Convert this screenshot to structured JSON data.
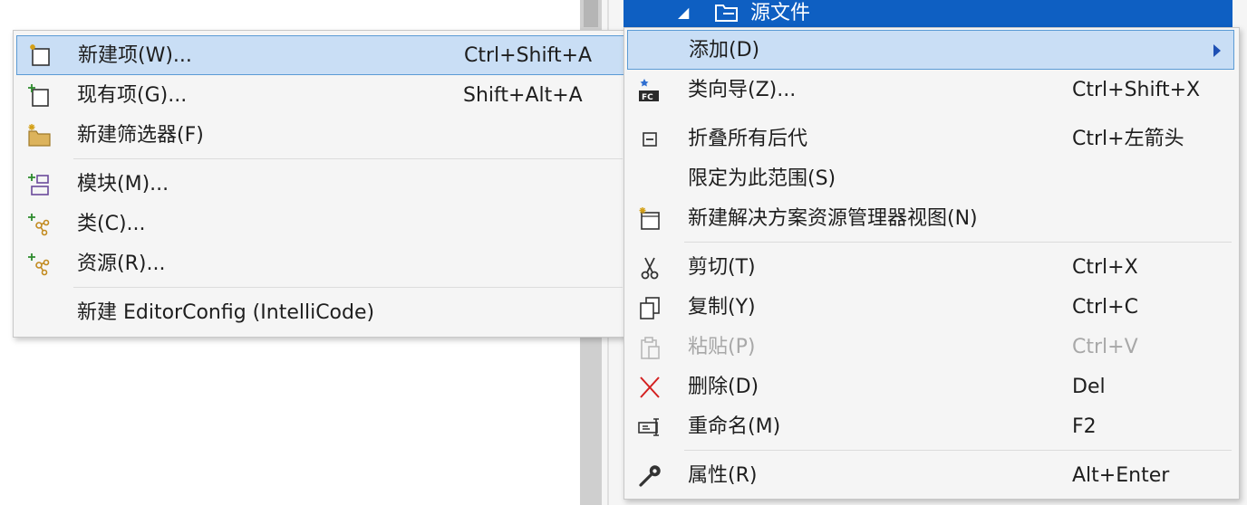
{
  "tree": {
    "selected_label": "源文件"
  },
  "left_menu": {
    "items": [
      {
        "label": "新建项(W)...",
        "shortcut": "Ctrl+Shift+A",
        "icon": "new-item-icon"
      },
      {
        "label": "现有项(G)...",
        "shortcut": "Shift+Alt+A",
        "icon": "existing-item-icon"
      },
      {
        "label": "新建筛选器(F)",
        "shortcut": "",
        "icon": "new-filter-folder-icon"
      },
      {
        "label": "模块(M)...",
        "shortcut": "",
        "icon": "module-icon"
      },
      {
        "label": "类(C)...",
        "shortcut": "",
        "icon": "class-icon"
      },
      {
        "label": "资源(R)...",
        "shortcut": "",
        "icon": "resource-icon"
      },
      {
        "label": "新建 EditorConfig (IntelliCode)",
        "shortcut": "",
        "icon": ""
      }
    ]
  },
  "right_menu": {
    "items": [
      {
        "label": "添加(D)",
        "shortcut": "",
        "icon": ""
      },
      {
        "label": "类向导(Z)...",
        "shortcut": "Ctrl+Shift+X",
        "icon": "class-wizard-icon"
      },
      {
        "label": "折叠所有后代",
        "shortcut": "Ctrl+左箭头",
        "icon": "collapse-icon"
      },
      {
        "label": "限定为此范围(S)",
        "shortcut": "",
        "icon": ""
      },
      {
        "label": "新建解决方案资源管理器视图(N)",
        "shortcut": "",
        "icon": "new-view-icon"
      },
      {
        "label": "剪切(T)",
        "shortcut": "Ctrl+X",
        "icon": "cut-icon"
      },
      {
        "label": "复制(Y)",
        "shortcut": "Ctrl+C",
        "icon": "copy-icon"
      },
      {
        "label": "粘贴(P)",
        "shortcut": "Ctrl+V",
        "icon": "paste-icon"
      },
      {
        "label": "删除(D)",
        "shortcut": "Del",
        "icon": "delete-icon"
      },
      {
        "label": "重命名(M)",
        "shortcut": "F2",
        "icon": "rename-icon"
      },
      {
        "label": "属性(R)",
        "shortcut": "Alt+Enter",
        "icon": "properties-icon"
      }
    ]
  },
  "colors": {
    "highlight_bg": "#c9def5",
    "highlight_border": "#5b9bd5",
    "tree_selection": "#0e5fc2",
    "disabled_text": "#a8a8a8"
  }
}
